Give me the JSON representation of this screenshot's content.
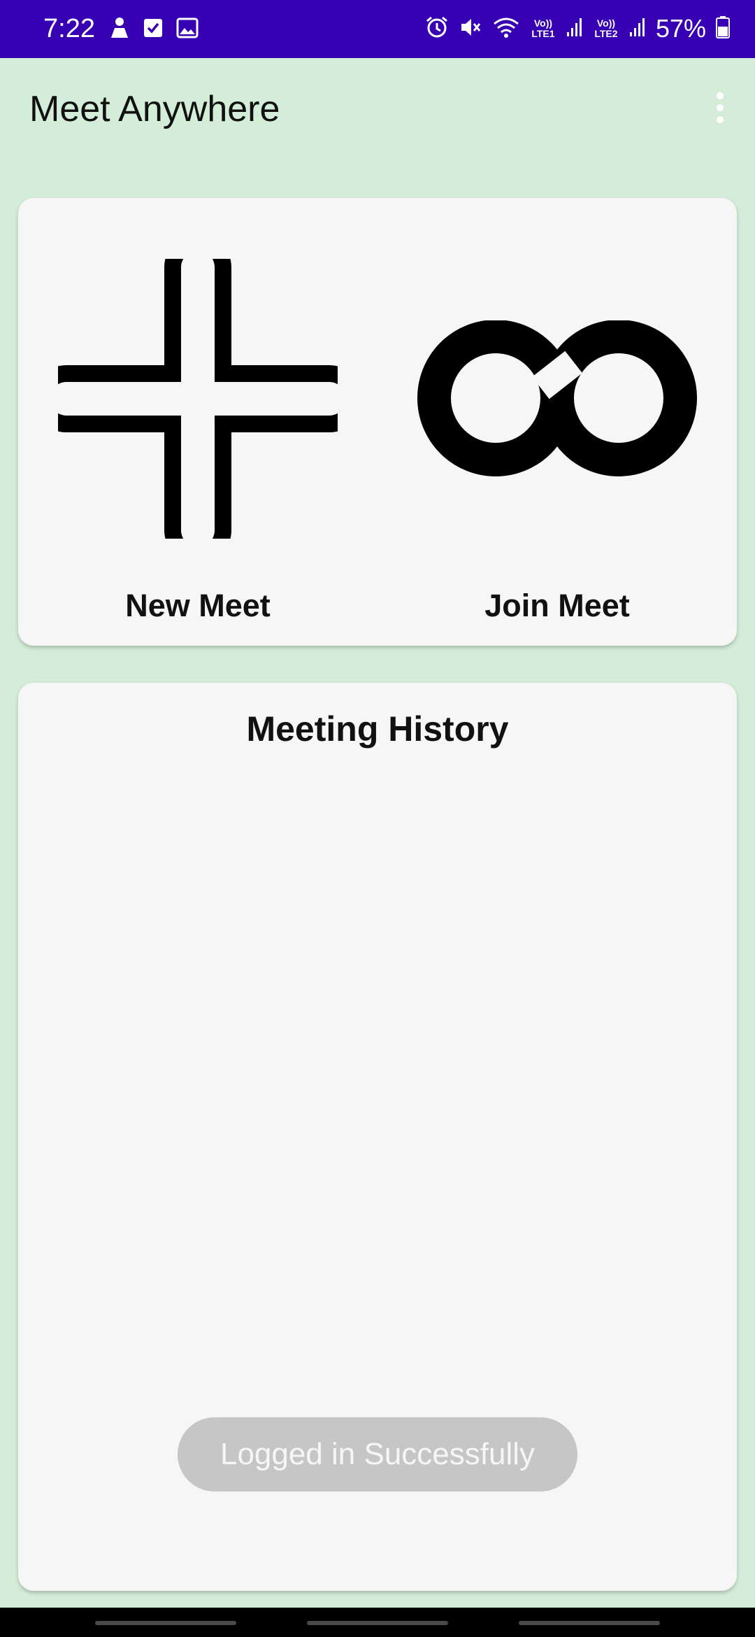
{
  "status_bar": {
    "time": "7:22",
    "sim1": "Vo)) LTE1",
    "sim2": "Vo)) LTE2",
    "battery": "57%",
    "left_icons": [
      "notification-person-icon",
      "checkbox-icon",
      "image-icon"
    ],
    "right_icons": [
      "alarm-icon",
      "mute-icon",
      "wifi-icon",
      "signal-icon",
      "battery-icon"
    ],
    "background": "#3700b3"
  },
  "app_bar": {
    "title": "Meet Anywhere",
    "menu_icon": "more-vertical-icon"
  },
  "actions": {
    "new_meet": {
      "label": "New Meet",
      "icon": "plus-icon"
    },
    "join_meet": {
      "label": "Join Meet",
      "icon": "infinity-icon"
    }
  },
  "history": {
    "title": "Meeting History",
    "items": []
  },
  "toast": {
    "message": "Logged in Successfully"
  },
  "colors": {
    "page_background": "#d4edd8",
    "card_background": "#f6f6f6",
    "toast_background": "#c6c6c6"
  }
}
